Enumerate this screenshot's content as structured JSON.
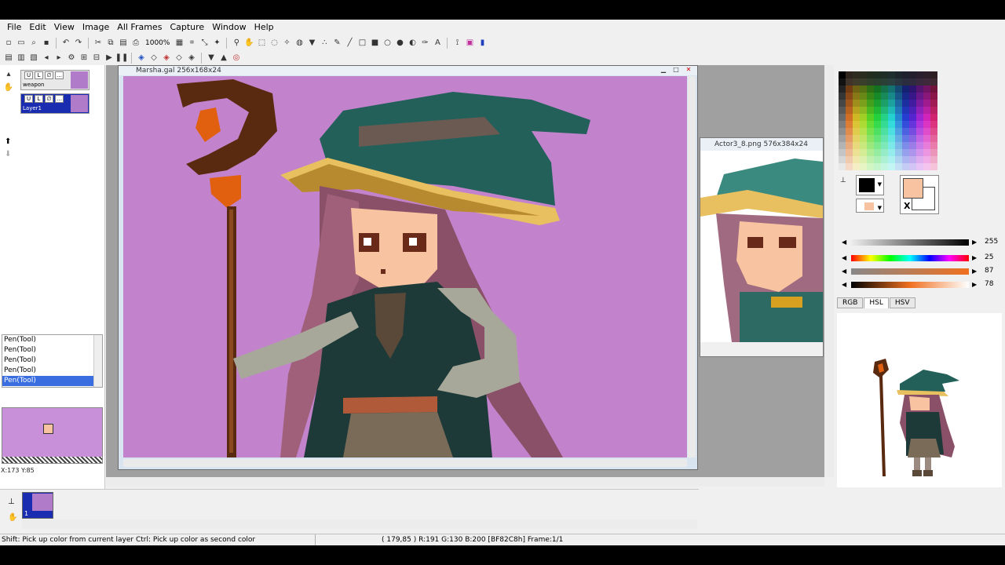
{
  "menu": [
    "File",
    "Edit",
    "View",
    "Image",
    "All Frames",
    "Capture",
    "Window",
    "Help"
  ],
  "toolbar": {
    "zoom": "1000%",
    "icons_row1": [
      "new-icon",
      "open-icon",
      "search-icon",
      "save-icon",
      "undo-icon",
      "redo-icon",
      "cut-icon",
      "copy-icon",
      "paste-icon",
      "print-icon",
      "zoom-level",
      "grid-icon",
      "crop-icon",
      "resize-icon",
      "magnify-icon",
      "hand-icon",
      "select-rect-icon",
      "select-lasso-icon",
      "magic-wand-icon",
      "stamp-icon",
      "fill-icon",
      "pen-icon",
      "line-icon",
      "rect-icon",
      "filled-rect-icon",
      "ellipse-icon",
      "filled-ellipse-icon",
      "spray-icon",
      "text-icon",
      "eyedropper-icon",
      "palette-icon",
      "pencil-icon"
    ],
    "icons_row2": [
      "layer-new-icon",
      "layer-copy-icon",
      "layer-delete-icon",
      "prev-frame-icon",
      "next-frame-icon",
      "frame-props-icon",
      "add-frame-icon",
      "dup-frame-icon",
      "play-icon",
      "pause-icon",
      "onion-icon",
      "onion2-icon",
      "onion3-icon",
      "onion4-icon",
      "onion5-icon",
      "down-icon",
      "up-icon",
      "settings-icon"
    ]
  },
  "layers": [
    {
      "name": "weapon",
      "selected": false
    },
    {
      "name": "Layer1",
      "selected": true
    }
  ],
  "history": {
    "items": [
      "Pen(Tool)",
      "Pen(Tool)",
      "Pen(Tool)",
      "Pen(Tool)",
      "Pen(Tool)"
    ],
    "selected_index": 4
  },
  "navigator": {
    "coords": "X:173 Y:85"
  },
  "documents": [
    {
      "title": "Marsha.gal 256x168x24"
    },
    {
      "title": "Actor3_8.png 576x384x24"
    }
  ],
  "color": {
    "foreground": "#000000",
    "secondary": "#f7c3a0",
    "swatch_label": "X",
    "sliders": [
      {
        "label": "alpha",
        "value": "255"
      },
      {
        "label": "hue",
        "value": "25"
      },
      {
        "label": "saturation",
        "value": "87"
      },
      {
        "label": "lightness",
        "value": "78"
      }
    ],
    "tabs": [
      "RGB",
      "HSL",
      "HSV"
    ],
    "active_tab": "HSL"
  },
  "frames": {
    "frame_number": "1"
  },
  "status": {
    "hint": "Shift: Pick up color from current layer  Ctrl: Pick up color as second color",
    "info": "( 179,85 ) R:191 G:130 B:200  [BF82C8h]  Frame:1/1"
  }
}
